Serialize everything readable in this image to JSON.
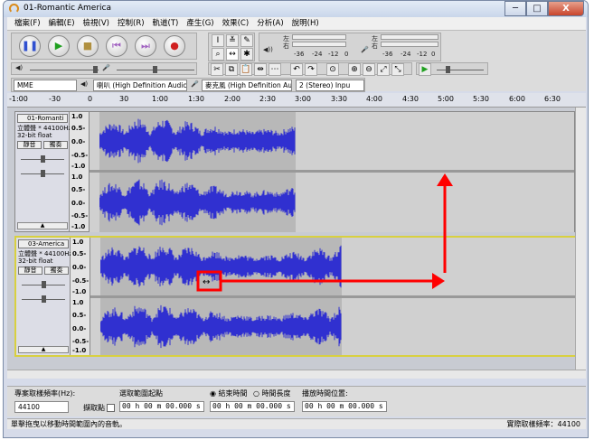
{
  "window": {
    "title": "01-Romantic America",
    "minimize": "─",
    "maximize": "□",
    "close": "X"
  },
  "menu": [
    "檔案(F)",
    "編輯(E)",
    "檢視(V)",
    "控制(R)",
    "軌道(T)",
    "產生(G)",
    "效果(C)",
    "分析(A)",
    "說明(H)"
  ],
  "meters": {
    "left": "左",
    "right": "右",
    "ticks": [
      "-36",
      "-24",
      "-12",
      "0"
    ]
  },
  "devices": {
    "host": "MME",
    "output": "喇叭 (High Definition Audic",
    "input": "麥克風 (High Definition Au",
    "channels": "2 (Stereo) Inpu"
  },
  "ruler": [
    "-1:00",
    "-30",
    "0",
    "30",
    "1:00",
    "1:30",
    "2:00",
    "2:30",
    "3:00",
    "3:30",
    "4:00",
    "4:30",
    "5:00",
    "5:30",
    "6:00",
    "6:30"
  ],
  "tracks": [
    {
      "name": "01-Romanti",
      "info1": "立體聲 * 44100Hz",
      "info2": "32-bit float",
      "mute": "靜音",
      "solo": "獨奏",
      "scale": [
        "1.0",
        "0.5-",
        "0.0-",
        "-0.5-",
        "-1.0"
      ],
      "length_min": 2.75
    },
    {
      "name": "03-America",
      "info1": "立體聲 * 44100Hz",
      "info2": "32-bit float",
      "mute": "靜音",
      "solo": "獨奏",
      "scale": [
        "1.0",
        "0.5-",
        "0.0-",
        "-0.5-",
        "-1.0"
      ],
      "length_min": 3.38
    }
  ],
  "selection": {
    "rate_label": "專案取樣頻率(Hz):",
    "rate_value": "44100",
    "snap_label": "擷取點",
    "start_label": "選取範圍起點",
    "end_option": "結束時間",
    "length_option": "時間長度",
    "end_length_label": "",
    "pos_label": "播放時間位置:",
    "start_value": "00 h 00 m 00.000 s",
    "end_value": "00 h 00 m 00.000 s",
    "pos_value": "00 h 00 m 00.000 s"
  },
  "status": {
    "message": "單擊拖曳以移動時間範圍內的音軌。",
    "rate": "實際取樣頻率：44100"
  },
  "colors": {
    "waveform": "#3030d0",
    "annotation": "#ff0000"
  }
}
